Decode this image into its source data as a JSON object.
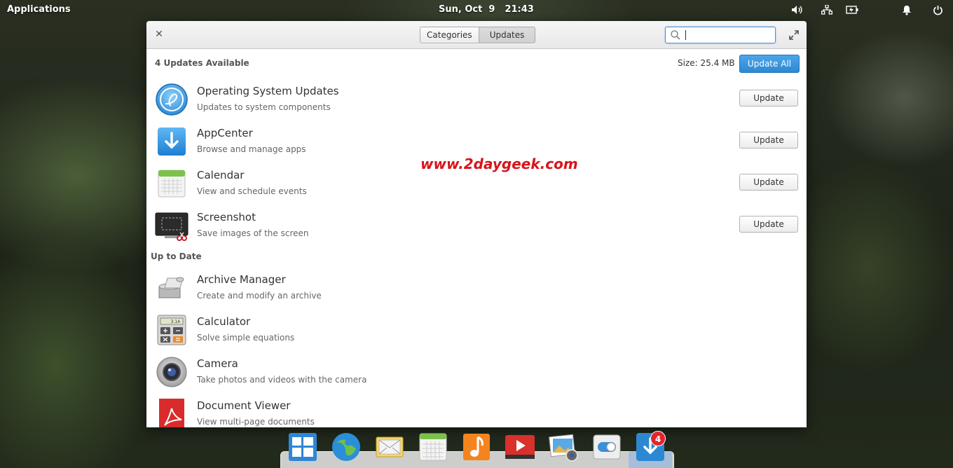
{
  "panel": {
    "applications_label": "Applications",
    "date": "Sun, Oct  9",
    "time": "21:43",
    "tray_icons": [
      "volume-icon",
      "network-icon",
      "battery-icon",
      "notifications-icon",
      "power-icon"
    ]
  },
  "window": {
    "tabs": [
      {
        "label": "Categories"
      },
      {
        "label": "Updates"
      }
    ],
    "search": {
      "value": "",
      "placeholder": ""
    },
    "updates_header": "4 Updates Available",
    "size_label": "Size: 25.4 MB",
    "update_all_label": "Update All",
    "update_button_label": "Update",
    "uptodate_header": "Up to Date",
    "updates": [
      {
        "name": "Operating System Updates",
        "desc": "Updates to system components",
        "icon": "elementary-logo-icon"
      },
      {
        "name": "AppCenter",
        "desc": "Browse and manage apps",
        "icon": "appcenter-icon"
      },
      {
        "name": "Calendar",
        "desc": "View and schedule events",
        "icon": "calendar-icon"
      },
      {
        "name": "Screenshot",
        "desc": "Save images of the screen",
        "icon": "screenshot-icon"
      }
    ],
    "uptodate": [
      {
        "name": "Archive Manager",
        "desc": "Create and modify an archive",
        "icon": "archive-manager-icon"
      },
      {
        "name": "Calculator",
        "desc": "Solve simple equations",
        "icon": "calculator-icon"
      },
      {
        "name": "Camera",
        "desc": "Take photos and videos with the camera",
        "icon": "camera-icon"
      },
      {
        "name": "Document Viewer",
        "desc": "View multi-page documents",
        "icon": "document-viewer-icon"
      }
    ],
    "watermark": "www.2daygeek.com"
  },
  "dock": {
    "items": [
      "multitasking-icon",
      "browser-icon",
      "mail-icon",
      "calendar-icon",
      "music-icon",
      "videos-icon",
      "photos-icon",
      "settings-icon",
      "appcenter-icon"
    ],
    "badge_count": "4"
  },
  "colors": {
    "accent": "#3d8fd6",
    "watermark": "#d8141a",
    "badge": "#e0262d"
  }
}
